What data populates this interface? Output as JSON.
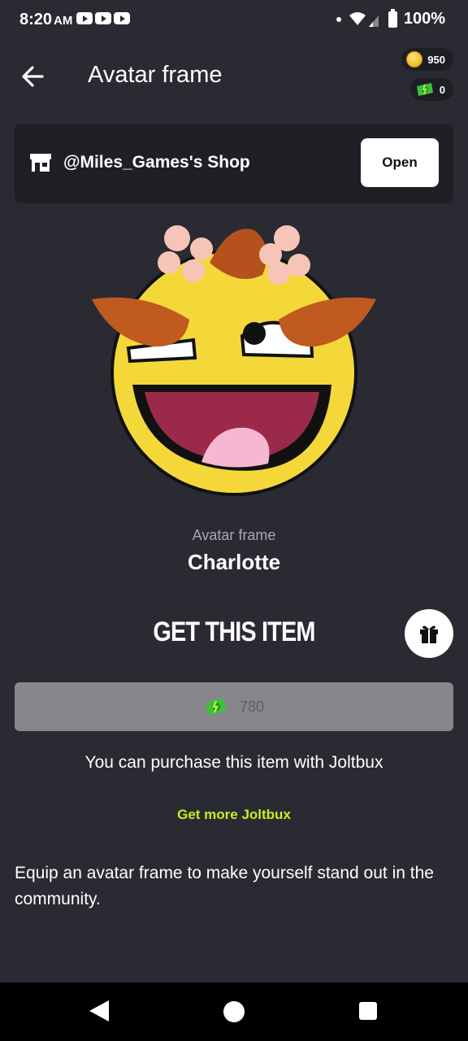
{
  "status_bar": {
    "time": "8:20",
    "ampm": "AM",
    "battery": "100%"
  },
  "header": {
    "title": "Avatar frame",
    "coins": "950",
    "joltbux": "0"
  },
  "shop": {
    "name": "@Miles_Games's Shop",
    "open_label": "Open"
  },
  "item": {
    "type": "Avatar frame",
    "name": "Charlotte"
  },
  "purchase": {
    "title": "GET THIS ITEM",
    "price": "780",
    "note": "You can purchase this item with Joltbux",
    "get_more": "Get more Joltbux"
  },
  "description": "Equip an avatar frame to make yourself stand out in the community.",
  "colors": {
    "background": "#2a2a33",
    "card": "#1f1f26",
    "accent": "#c6ef1e",
    "buy_button": "#87878b"
  }
}
